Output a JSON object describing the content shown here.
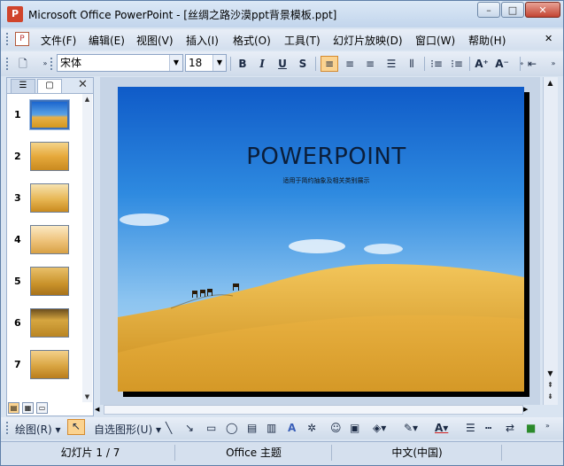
{
  "window": {
    "title": "Microsoft Office PowerPoint - [丝绸之路沙漠ppt背景模板.ppt]",
    "app_icon": "powerpoint-icon",
    "controls": {
      "minimize": "–",
      "maximize": "□",
      "close": "✕"
    }
  },
  "menu": {
    "items": [
      "文件(F)",
      "编辑(E)",
      "视图(V)",
      "插入(I)",
      "格式(O)",
      "工具(T)",
      "幻灯片放映(D)",
      "窗口(W)",
      "帮助(H)"
    ],
    "close": "✕"
  },
  "toolbar": {
    "new": "🗋",
    "font_name": "宋体",
    "font_size": "18",
    "bold": "B",
    "italic": "I",
    "underline": "U",
    "shadow": "S",
    "align_left": "≡",
    "align_center": "≡",
    "align_right": "≡",
    "distribute": "⦀",
    "numbering": "⁝≡",
    "bullets": "⁝≡",
    "increase_font": "A⁺",
    "decrease_font": "A⁻",
    "decrease_indent": "⇤"
  },
  "outline_pane": {
    "tab_outline": "☰",
    "tab_slides": "▢",
    "close": "✕",
    "slides": [
      {
        "num": "1"
      },
      {
        "num": "2"
      },
      {
        "num": "3"
      },
      {
        "num": "4"
      },
      {
        "num": "5"
      },
      {
        "num": "6"
      },
      {
        "num": "7"
      }
    ],
    "selected_index": 0,
    "scroll_up": "▲",
    "scroll_down": "▼"
  },
  "slide": {
    "title": "POWERPOINT",
    "subtitle": "适用于简约抽象及相关类别展示"
  },
  "vertical_scroll": {
    "up": "▲",
    "down": "▼",
    "prev": "⇞",
    "next": "⇟"
  },
  "drawing_toolbar": {
    "draw_menu": "绘图(R)",
    "autoshapes": "自选图形(U)"
  },
  "status": {
    "slide": "幻灯片 1 / 7",
    "theme": "Office 主题",
    "language": "中文(中国)"
  },
  "colors": {
    "sky_top": "#0f5bc8",
    "sand": "#e4a62a",
    "accent_orange": "#fbd390"
  }
}
